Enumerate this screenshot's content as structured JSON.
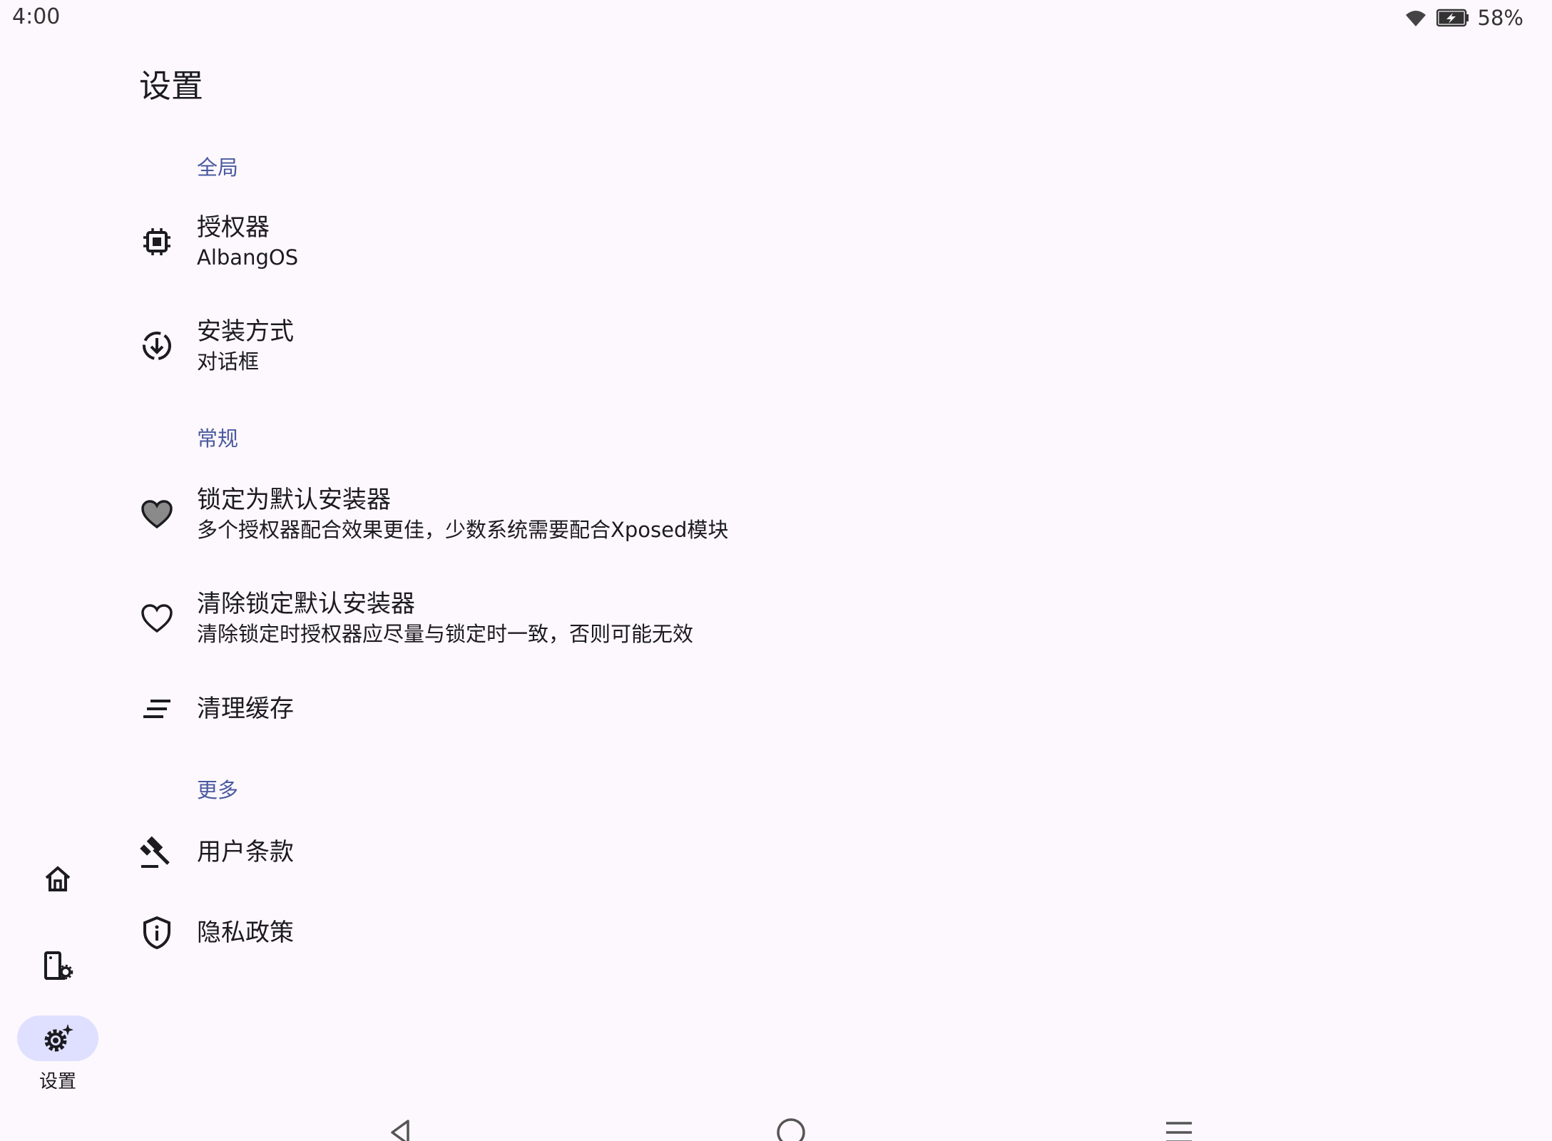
{
  "status_bar": {
    "time": "4:00",
    "battery_percent": "58%",
    "icons": [
      "wifi-icon",
      "battery-charging-icon"
    ]
  },
  "page": {
    "title": "设置"
  },
  "sections": {
    "global": {
      "header": "全局",
      "items": {
        "authorizer": {
          "title": "授权器",
          "summary": "AlbangOS",
          "icon": "chip-icon"
        },
        "install_mode": {
          "title": "安装方式",
          "summary": "对话框",
          "icon": "install-download-icon"
        }
      }
    },
    "general": {
      "header": "常规",
      "items": {
        "lock_default": {
          "title": "锁定为默认安装器",
          "summary": "多个授权器配合效果更佳，少数系统需要配合Xposed模块",
          "icon": "heart-filled-icon"
        },
        "clear_lock": {
          "title": "清除锁定默认安装器",
          "summary": "清除锁定时授权器应尽量与锁定时一致，否则可能无效",
          "icon": "heart-outline-icon"
        },
        "clear_cache": {
          "title": "清理缓存",
          "icon": "clear-all-icon"
        }
      }
    },
    "more": {
      "header": "更多",
      "items": {
        "terms": {
          "title": "用户条款",
          "icon": "gavel-icon"
        },
        "privacy": {
          "title": "隐私政策",
          "icon": "shield-info-icon"
        }
      }
    }
  },
  "nav_rail": {
    "home": {
      "icon": "home-icon"
    },
    "apps": {
      "icon": "app-settings-icon"
    },
    "settings": {
      "label": "设置",
      "icon": "settings-sparkle-icon",
      "active": true
    }
  },
  "system_nav": {
    "back": {
      "icon": "back-triangle-icon"
    },
    "home": {
      "icon": "home-circle-icon"
    },
    "recents": {
      "icon": "recents-menu-icon"
    }
  },
  "colors": {
    "background": "#fdf8fd",
    "accent": "#4a5aa0",
    "rail_active": "#dfe0ff",
    "text": "#1c1b1f"
  }
}
